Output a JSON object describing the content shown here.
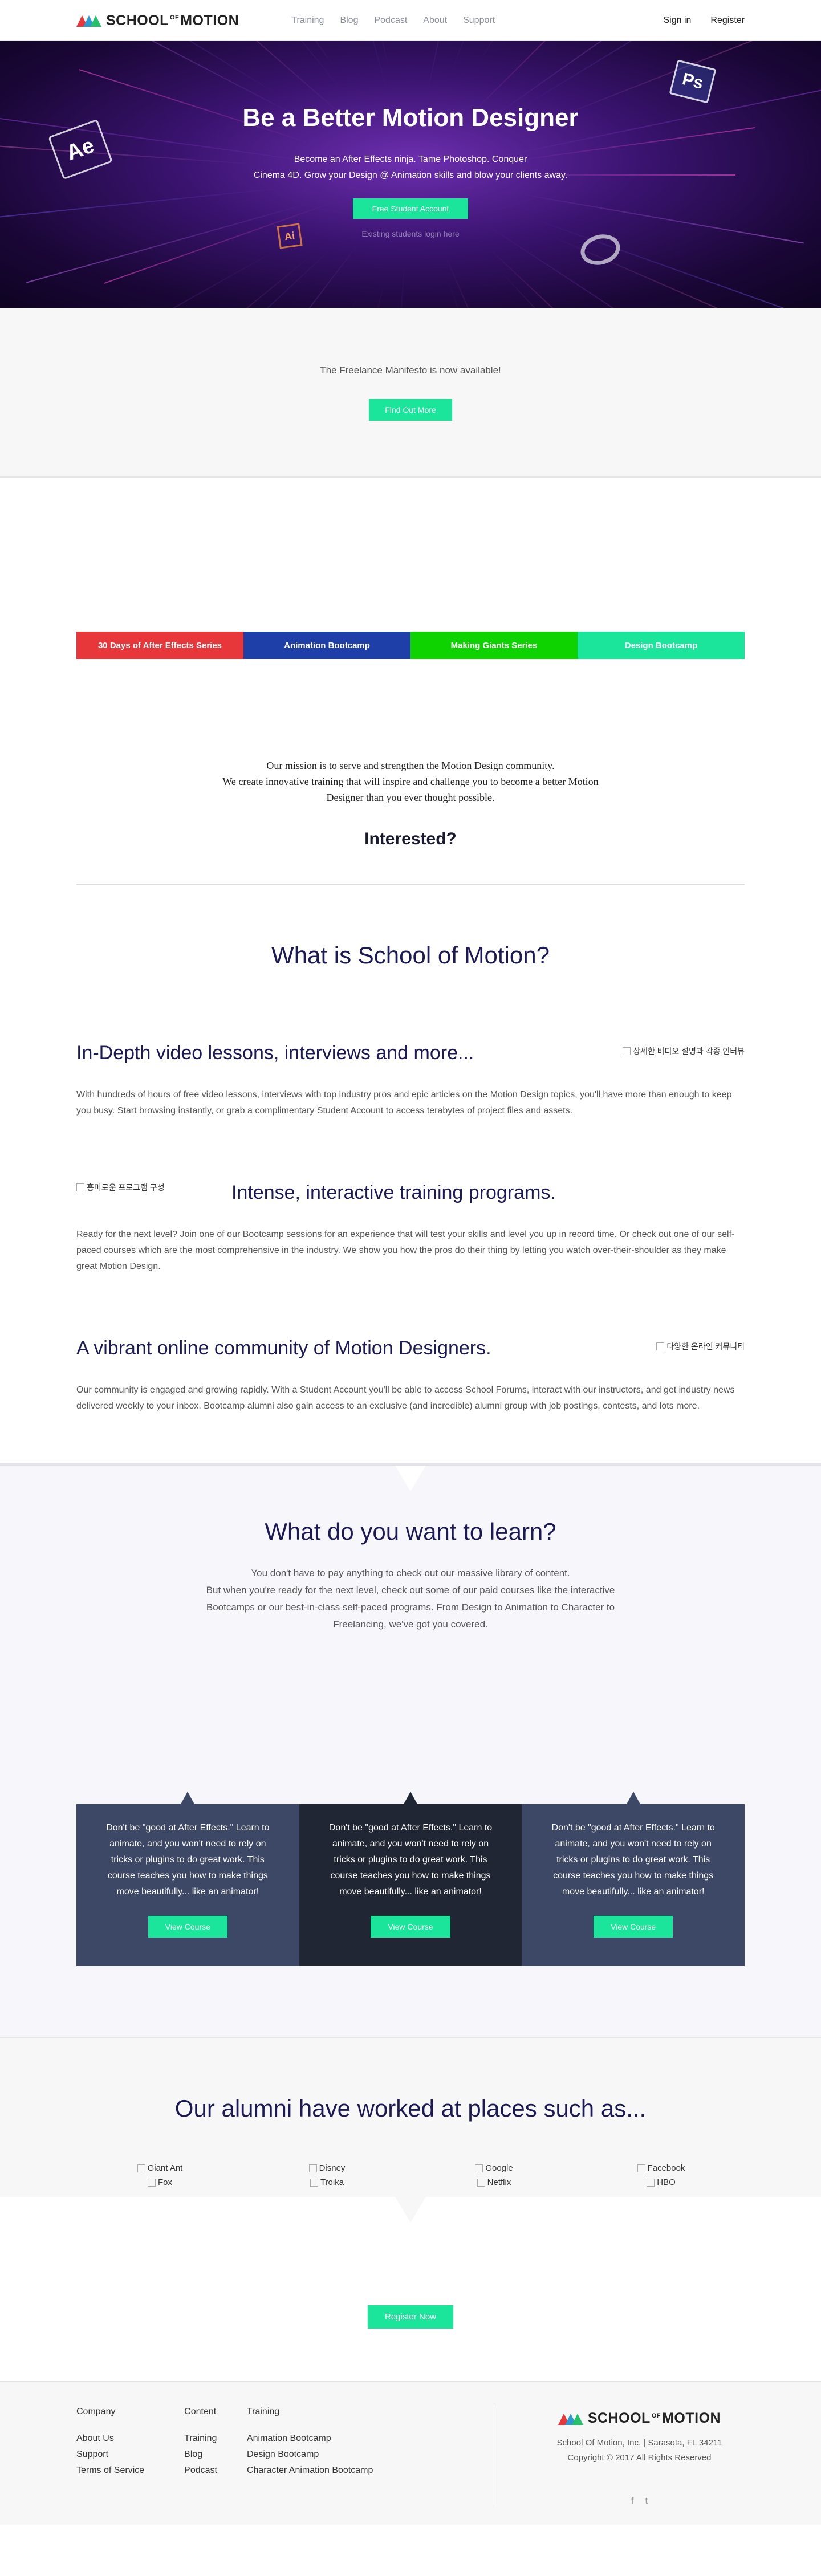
{
  "nav": {
    "logo": "SCHOOL",
    "logo_of": "OF",
    "logo_tail": "MOTION",
    "links": [
      "Training",
      "Blog",
      "Podcast",
      "About",
      "Support"
    ],
    "signin": "Sign in",
    "register": "Register"
  },
  "hero": {
    "title": "Be a Better Motion Designer",
    "subtitle_line1": "Become an After Effects ninja. Tame Photoshop. Conquer",
    "subtitle_line2": "Cinema 4D. Grow your Design @ Animation skills and blow your clients away.",
    "cta": "Free Student Account",
    "existing": "Existing students login here",
    "icons": {
      "ae": "Ae",
      "ps": "Ps",
      "ai": "Ai"
    }
  },
  "manifesto": {
    "text": "The Freelance Manifesto is now available!",
    "cta": "Find Out More"
  },
  "series": [
    {
      "label": "30 Days of After Effects Series",
      "color": "#e8373a"
    },
    {
      "label": "Animation Bootcamp",
      "color": "#1f3fa8"
    },
    {
      "label": "Making Giants Series",
      "color": "#0fd300"
    },
    {
      "label": "Design Bootcamp",
      "color": "#1be59a"
    }
  ],
  "mission": {
    "line1": "Our mission is to serve and strengthen the Motion Design community.",
    "line2": "We create innovative training that will inspire and challenge you to become a better Motion",
    "line3": "Designer than you ever thought possible.",
    "interested": "Interested?"
  },
  "what": {
    "title": "What is School of Motion?",
    "features": [
      {
        "title": "In-Depth video lessons, interviews and more...",
        "img_alt": "상세한 비디오 설명과 각종 인터뷰",
        "text": "With hundreds of hours of free video lessons, interviews with top industry pros and epic articles on the Motion Design topics, you'll have more than enough to keep you busy. Start browsing instantly, or grab a complimentary Student Account to access terabytes of project files and assets."
      },
      {
        "title": "Intense, interactive training programs.",
        "img_alt": "흥미로운 프로그램 구성",
        "text": "Ready for the next level? Join one of our Bootcamp sessions for an experience that will test your skills and level you up in record time. Or check out one of our self-paced courses which are the most comprehensive in the industry. We show you how the pros do their thing by letting you watch over-their-shoulder as they make great Motion Design."
      },
      {
        "title": "A vibrant online community of Motion Designers.",
        "img_alt": "다양한 온라인 커뮤니티",
        "text": "Our community is engaged and growing rapidly. With a Student Account you'll be able to access School Forums, interact with our instructors, and get industry news delivered weekly to your inbox. Bootcamp alumni also gain access to an exclusive (and incredible) alumni group with job postings, contests, and lots more."
      }
    ]
  },
  "learn": {
    "title": "What do you want to learn?",
    "line1": "You don't have to pay anything to check out our massive library of content.",
    "line2": "But when you're ready for the next level, check out some of our paid courses like the interactive",
    "line3": "Bootcamps or our best-in-class self-paced programs. From Design to Animation to Character to",
    "line4": "Freelancing, we've got you covered.",
    "cards": [
      {
        "text": "Don't be \"good at After Effects.\" Learn to animate, and you won't need to rely on tricks or plugins to do great work. This course teaches you how to make things move beautifully... like an animator!",
        "cta": "View Course",
        "color": "#3c4866"
      },
      {
        "text": "Don't be \"good at After Effects.\" Learn to animate, and you won't need to rely on tricks or plugins to do great work. This course teaches you how to make things move beautifully... like an animator!",
        "cta": "View Course",
        "color": "#212634"
      },
      {
        "text": "Don't be \"good at After Effects.\" Learn to animate, and you won't need to rely on tricks or plugins to do great work. This course teaches you how to make things move beautifully... like an animator!",
        "cta": "View Course",
        "color": "#3c4866"
      }
    ]
  },
  "alumni": {
    "title": "Our alumni have worked at places such as...",
    "logos": [
      [
        "Giant Ant",
        "Fox"
      ],
      [
        "Disney",
        "Troika"
      ],
      [
        "Google",
        "Netflix"
      ],
      [
        "Facebook",
        "HBO"
      ]
    ],
    "cta": "Register Now"
  },
  "footer": {
    "cols": [
      {
        "title": "Company",
        "links": [
          "About Us",
          "Support",
          "Terms of Service"
        ]
      },
      {
        "title": "Content",
        "links": [
          "Training",
          "Blog",
          "Podcast"
        ]
      },
      {
        "title": "Training",
        "links": [
          "Animation Bootcamp",
          "Design Bootcamp",
          "Character Animation Bootcamp"
        ]
      }
    ],
    "address": "School Of Motion, Inc. | Sarasota, FL 34211",
    "copyright": "Copyright © 2017 All Rights Reserved",
    "social": [
      "f",
      "t"
    ]
  }
}
